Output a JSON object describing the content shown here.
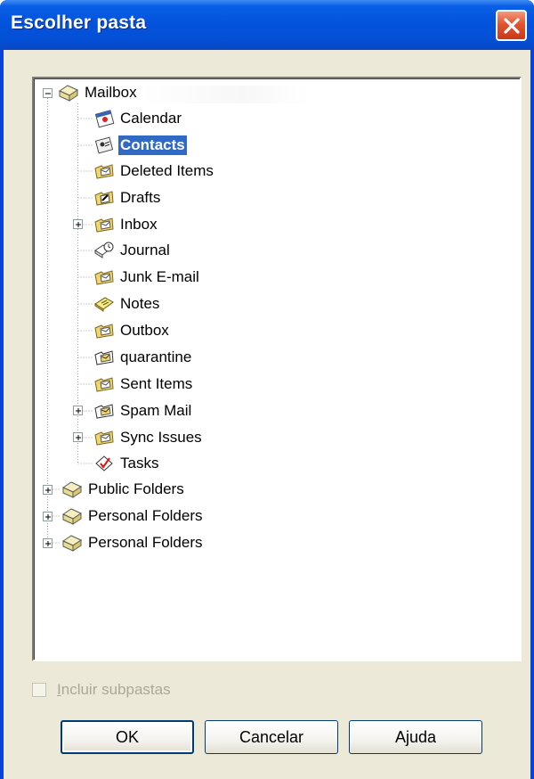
{
  "window": {
    "title": "Escolher pasta"
  },
  "tree": {
    "root": {
      "label": "Mailbox -",
      "expanded": true
    },
    "children": [
      {
        "label": "Calendar",
        "icon": "calendar-folder-icon"
      },
      {
        "label": "Contacts",
        "icon": "contacts-folder-icon",
        "selected": true
      },
      {
        "label": "Deleted Items",
        "icon": "deleted-items-folder-icon"
      },
      {
        "label": "Drafts",
        "icon": "drafts-folder-icon"
      },
      {
        "label": "Inbox",
        "icon": "inbox-folder-icon",
        "expandable": true
      },
      {
        "label": "Journal",
        "icon": "journal-folder-icon"
      },
      {
        "label": "Junk E-mail",
        "icon": "mail-folder-icon"
      },
      {
        "label": "Notes",
        "icon": "notes-folder-icon"
      },
      {
        "label": "Outbox",
        "icon": "mail-folder-icon"
      },
      {
        "label": "quarantine",
        "icon": "mail-folder-icon"
      },
      {
        "label": "Sent Items",
        "icon": "mail-folder-icon"
      },
      {
        "label": "Spam Mail",
        "icon": "mail-folder-icon",
        "expandable": true
      },
      {
        "label": "Sync Issues",
        "icon": "mail-folder-icon",
        "expandable": true
      },
      {
        "label": "Tasks",
        "icon": "tasks-folder-icon"
      }
    ],
    "top_level": [
      {
        "label": "Public Folders",
        "icon": "store-icon",
        "expandable": true
      },
      {
        "label": "Personal Folders",
        "icon": "store-icon",
        "expandable": true
      },
      {
        "label": "Personal Folders",
        "icon": "store-icon",
        "expandable": true
      }
    ]
  },
  "options": {
    "include_subfolders_label_first": "I",
    "include_subfolders_label_rest": "ncluir subpastas",
    "include_subfolders_checked": false,
    "include_subfolders_enabled": false
  },
  "buttons": {
    "ok": "OK",
    "cancel": "Cancelar",
    "help": "Ajuda"
  },
  "colors": {
    "titlebar": "#0453dc",
    "selection": "#316ac5",
    "dialog_bg": "#ece9d8",
    "close": "#e2542f"
  }
}
